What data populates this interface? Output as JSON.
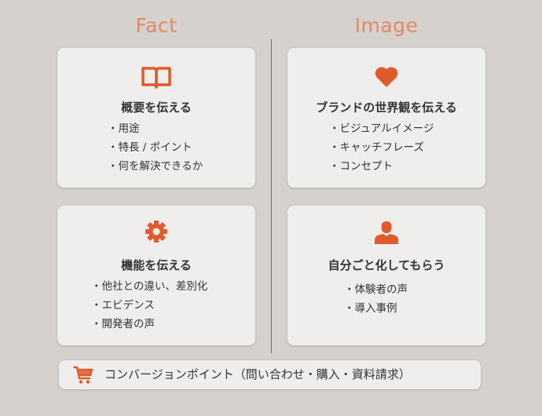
{
  "columns": {
    "left": "Fact",
    "right": "Image"
  },
  "cards": [
    {
      "icon": "book-icon",
      "title": "概要を伝える",
      "items": [
        "用途",
        "特長 / ポイント",
        "何を解決できるか"
      ]
    },
    {
      "icon": "heart-icon",
      "title": "ブランドの世界観を伝える",
      "items": [
        "ビジュアルイメージ",
        "キャッチフレーズ",
        "コンセプト"
      ]
    },
    {
      "icon": "gear-icon",
      "title": "機能を伝える",
      "items": [
        "他社との違い、差別化",
        "エビデンス",
        "開発者の声"
      ]
    },
    {
      "icon": "person-icon",
      "title": "自分ごと化してもらう",
      "items": [
        "体験者の声",
        "導入事例"
      ]
    }
  ],
  "cta": {
    "icon": "cart-icon",
    "text": "コンバージョンポイント（問い合わせ・購入・資料請求）"
  },
  "colors": {
    "accent": "#e05a2b",
    "title_accent": "#e08a68",
    "background": "#d5d1cc",
    "card": "#efeeed"
  }
}
